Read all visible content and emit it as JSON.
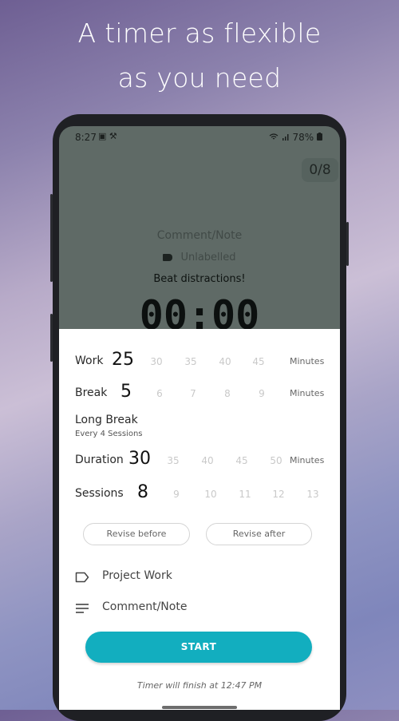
{
  "headline": {
    "line1": "A timer as flexible",
    "line2": "as you need"
  },
  "status_bar": {
    "time": "8:27",
    "icons_left": "▣ ⚒",
    "battery": "78%"
  },
  "background": {
    "session_counter": "0/8",
    "comment_placeholder": "Comment/Note",
    "label": "Unlabelled",
    "motto": "Beat distractions!",
    "timer": "00:00"
  },
  "settings": {
    "work": {
      "label": "Work",
      "value": "25",
      "options": [
        "30",
        "35",
        "40",
        "45"
      ],
      "unit": "Minutes"
    },
    "break": {
      "label": "Break",
      "value": "5",
      "options": [
        "6",
        "7",
        "8",
        "9"
      ],
      "unit": "Minutes"
    },
    "long_break": {
      "label": "Long Break",
      "sub_label": "Every 4 Sessions"
    },
    "duration": {
      "label": "Duration",
      "value": "30",
      "options": [
        "35",
        "40",
        "45",
        "50"
      ],
      "unit": "Minutes"
    },
    "sessions": {
      "label": "Sessions",
      "value": "8",
      "options": [
        "9",
        "10",
        "11",
        "12",
        "13"
      ]
    }
  },
  "chips": {
    "revise_before": "Revise before",
    "revise_after": "Revise after"
  },
  "project": {
    "label": "Project Work",
    "icon": "label-tag-icon"
  },
  "comment": {
    "placeholder": "Comment/Note",
    "icon": "notes-lines-icon"
  },
  "start_button": "START",
  "finish_text": "Timer will finish at 12:47 PM",
  "colors": {
    "accent": "#12aebf",
    "overlay": "#5f6a66"
  }
}
